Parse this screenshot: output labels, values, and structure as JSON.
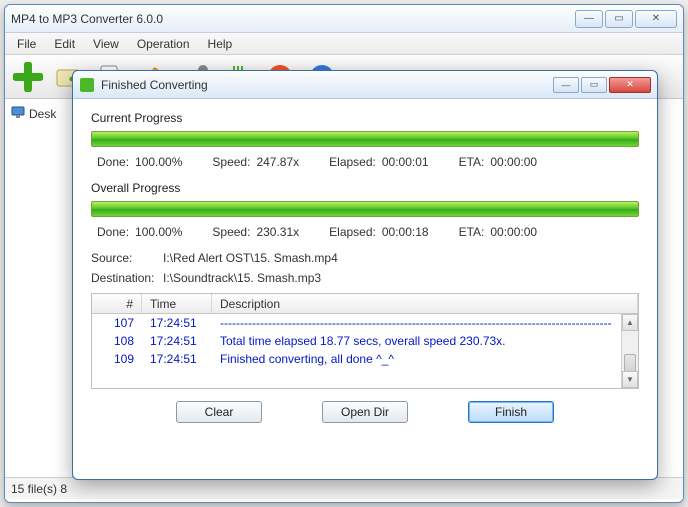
{
  "main": {
    "title": "MP4 to MP3 Converter 6.0.0",
    "menu": [
      "File",
      "Edit",
      "View",
      "Operation",
      "Help"
    ],
    "sidebar_item": "Desk",
    "status": "15 file(s)   8"
  },
  "dialog": {
    "title": "Finished Converting",
    "current_label": "Current Progress",
    "overall_label": "Overall Progress",
    "labels": {
      "done": "Done:",
      "speed": "Speed:",
      "elapsed": "Elapsed:",
      "eta": "ETA:"
    },
    "current": {
      "done": "100.00%",
      "speed": "247.87x",
      "elapsed": "00:00:01",
      "eta": "00:00:00"
    },
    "overall": {
      "done": "100.00%",
      "speed": "230.31x",
      "elapsed": "00:00:18",
      "eta": "00:00:00"
    },
    "source_label": "Source:",
    "source": "I:\\Red Alert OST\\15. Smash.mp4",
    "dest_label": "Destination:",
    "dest": "I:\\Soundtrack\\15. Smash.mp3",
    "columns": {
      "n": "#",
      "time": "Time",
      "desc": "Description"
    },
    "rows": [
      {
        "n": "107",
        "time": "17:24:51",
        "desc": "--------------------------------------------------------------------------------------------------"
      },
      {
        "n": "108",
        "time": "17:24:51",
        "desc": "Total time elapsed 18.77 secs, overall speed 230.73x."
      },
      {
        "n": "109",
        "time": "17:24:51",
        "desc": "Finished converting, all done ^_^"
      }
    ],
    "buttons": {
      "clear": "Clear",
      "open": "Open Dir",
      "finish": "Finish"
    }
  }
}
